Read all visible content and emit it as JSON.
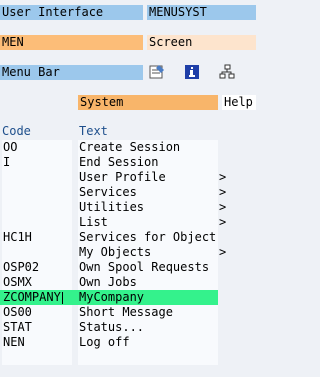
{
  "header": {
    "ui_label": "User Interface",
    "ui_value": "MENUSYST",
    "type_value": "MEN",
    "type_label": "Screen",
    "menu_bar_label": "Menu Bar"
  },
  "toolbar": {
    "icons": [
      "edit-icon",
      "info-icon",
      "hierarchy-icon"
    ]
  },
  "tabs": {
    "system": "System",
    "help": "Help"
  },
  "table": {
    "headers": {
      "code": "Code",
      "text": "Text"
    },
    "rows": [
      {
        "code": "OO",
        "text": "Create Session",
        "arrow": ""
      },
      {
        "code": "I",
        "text": "End Session",
        "arrow": ""
      },
      {
        "code": "",
        "text": "User Profile",
        "arrow": ">"
      },
      {
        "code": "",
        "text": "Services",
        "arrow": ">"
      },
      {
        "code": "",
        "text": "Utilities",
        "arrow": ">"
      },
      {
        "code": "",
        "text": "List",
        "arrow": ">"
      },
      {
        "code": "HC1H",
        "text": "Services for Object",
        "arrow": ""
      },
      {
        "code": "",
        "text": "My Objects",
        "arrow": ">"
      },
      {
        "code": "OSP02",
        "text": "Own Spool Requests",
        "arrow": ""
      },
      {
        "code": "OSMX",
        "text": "Own Jobs",
        "arrow": ""
      },
      {
        "code": "ZCOMPANY",
        "text": "MyCompany",
        "arrow": ""
      },
      {
        "code": "OS00",
        "text": "Short Message",
        "arrow": ""
      },
      {
        "code": "STAT",
        "text": "Status...",
        "arrow": ""
      },
      {
        "code": "NEN",
        "text": "Log off",
        "arrow": ""
      },
      {
        "code": "",
        "text": "",
        "arrow": ""
      }
    ],
    "selected_index": 10
  },
  "colors": {
    "label_blue": "#9cc8ec",
    "field_orange": "#fcbd78",
    "selected_green": "#34f28c"
  }
}
